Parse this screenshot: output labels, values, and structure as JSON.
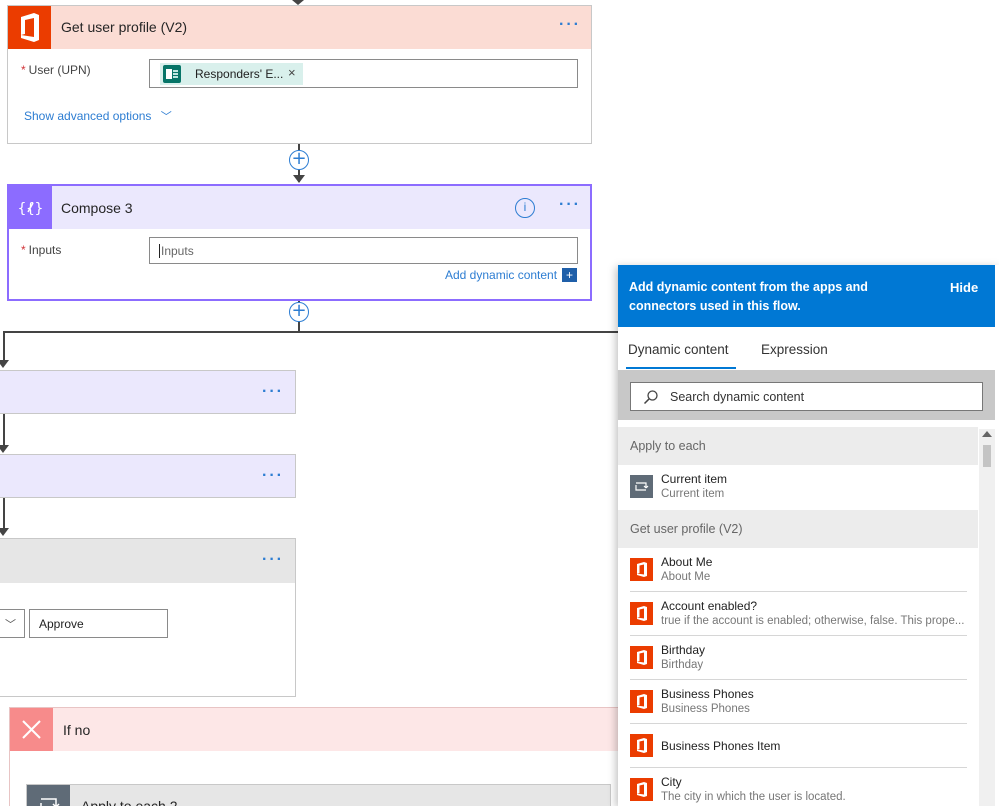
{
  "get_user_profile": {
    "title": "Get user profile (V2)",
    "field_label": "User (UPN)",
    "token_label": "Responders' E...",
    "advanced_options_label": "Show advanced options",
    "header_color": "#fbdcd4",
    "icon_color": "#eb3c00"
  },
  "compose": {
    "title": "Compose 3",
    "field_label": "Inputs",
    "input_placeholder": "Inputs",
    "add_dynamic_content_label": "Add dynamic content",
    "header_color": "#ebe8fd",
    "icon_color": "#8c6cff"
  },
  "branch": {
    "approve_value": "Approve"
  },
  "if_no": {
    "title": "If no",
    "apply_to_each_title": "Apply to each 2"
  },
  "panel": {
    "header_text": "Add dynamic content from the apps and connectors used in this flow.",
    "hide_label": "Hide",
    "tabs": [
      {
        "label": "Dynamic content",
        "active": true
      },
      {
        "label": "Expression",
        "active": false
      }
    ],
    "search_placeholder": "Search dynamic content",
    "sections": [
      {
        "name": "Apply to each",
        "items": [
          {
            "title": "Current item",
            "subtitle": "Current item",
            "icon": "loop-icon"
          }
        ]
      },
      {
        "name": "Get user profile (V2)",
        "items": [
          {
            "title": "About Me",
            "subtitle": "About Me",
            "icon": "office-icon"
          },
          {
            "title": "Account enabled?",
            "subtitle": "true if the account is enabled; otherwise, false. This prope...",
            "icon": "office-icon"
          },
          {
            "title": "Birthday",
            "subtitle": "Birthday",
            "icon": "office-icon"
          },
          {
            "title": "Business Phones",
            "subtitle": "Business Phones",
            "icon": "office-icon"
          },
          {
            "title": "Business Phones Item",
            "subtitle": "",
            "icon": "office-icon"
          },
          {
            "title": "City",
            "subtitle": "The city in which the user is located.",
            "icon": "office-icon"
          }
        ]
      }
    ]
  }
}
